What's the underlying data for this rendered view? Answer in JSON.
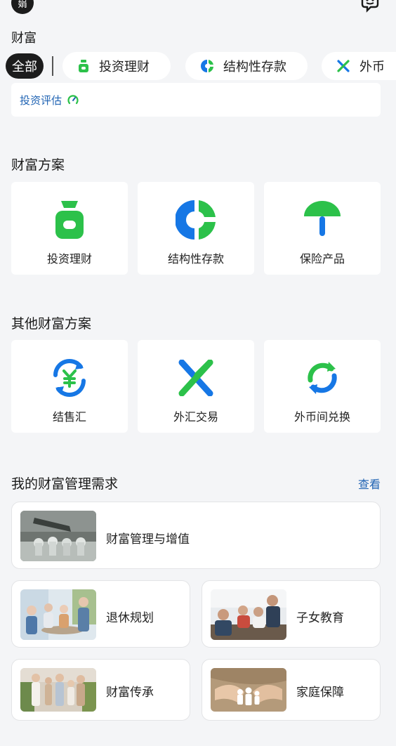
{
  "header": {
    "avatar_text": "娟",
    "title": "财富"
  },
  "filter_chips": {
    "all": "全部",
    "items": [
      {
        "label": "投资理财",
        "icon": "moneybag-icon"
      },
      {
        "label": "结构性存款",
        "icon": "pie-icon"
      },
      {
        "label": "外币",
        "icon": "cross-arrows-icon"
      }
    ]
  },
  "assessment": {
    "label": "投资评估",
    "icon": "gauge-icon"
  },
  "wealth_plans": {
    "title": "财富方案",
    "items": [
      {
        "label": "投资理财",
        "icon": "moneybag-icon"
      },
      {
        "label": "结构性存款",
        "icon": "pie-icon"
      },
      {
        "label": "保险产品",
        "icon": "umbrella-icon"
      }
    ]
  },
  "other_plans": {
    "title": "其他财富方案",
    "items": [
      {
        "label": "结售汇",
        "icon": "yuan-exchange-icon"
      },
      {
        "label": "外汇交易",
        "icon": "cross-arrows-icon"
      },
      {
        "label": "外币间兑换",
        "icon": "refresh-icon"
      }
    ]
  },
  "needs": {
    "title": "我的财富管理需求",
    "see_label": "查看",
    "items": [
      {
        "label": "财富管理与增值"
      },
      {
        "label": "退休规划"
      },
      {
        "label": "子女教育"
      },
      {
        "label": "财富传承"
      },
      {
        "label": "家庭保障"
      }
    ]
  },
  "colors": {
    "brand_green": "#2cc14a",
    "brand_blue": "#1677e5",
    "link_blue": "#1f63b3"
  }
}
